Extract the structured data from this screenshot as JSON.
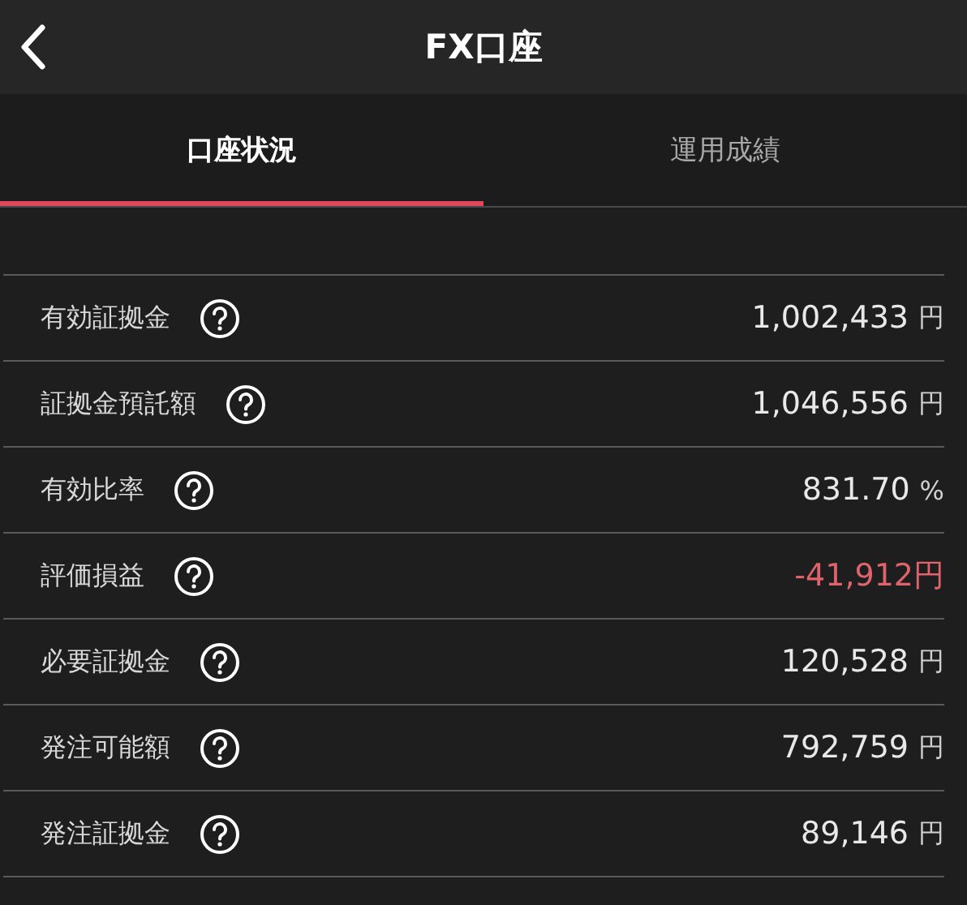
{
  "header": {
    "title": "FX口座"
  },
  "tabs": [
    {
      "label": "口座状況",
      "selected": true
    },
    {
      "label": "運用成績",
      "selected": false
    }
  ],
  "rows": [
    {
      "label": "有効証拠金",
      "value": "1,002,433",
      "unit": "円",
      "negative": false
    },
    {
      "label": "証拠金預託額",
      "value": "1,046,556",
      "unit": "円",
      "negative": false
    },
    {
      "label": "有効比率",
      "value": "831.70",
      "unit": "%",
      "negative": false
    },
    {
      "label": "評価損益",
      "value": "-41,912",
      "unit": "円",
      "negative": true
    },
    {
      "label": "必要証拠金",
      "value": "120,528",
      "unit": "円",
      "negative": false
    },
    {
      "label": "発注可能額",
      "value": "792,759",
      "unit": "円",
      "negative": false
    },
    {
      "label": "発注証拠金",
      "value": "89,146",
      "unit": "円",
      "negative": false
    }
  ]
}
